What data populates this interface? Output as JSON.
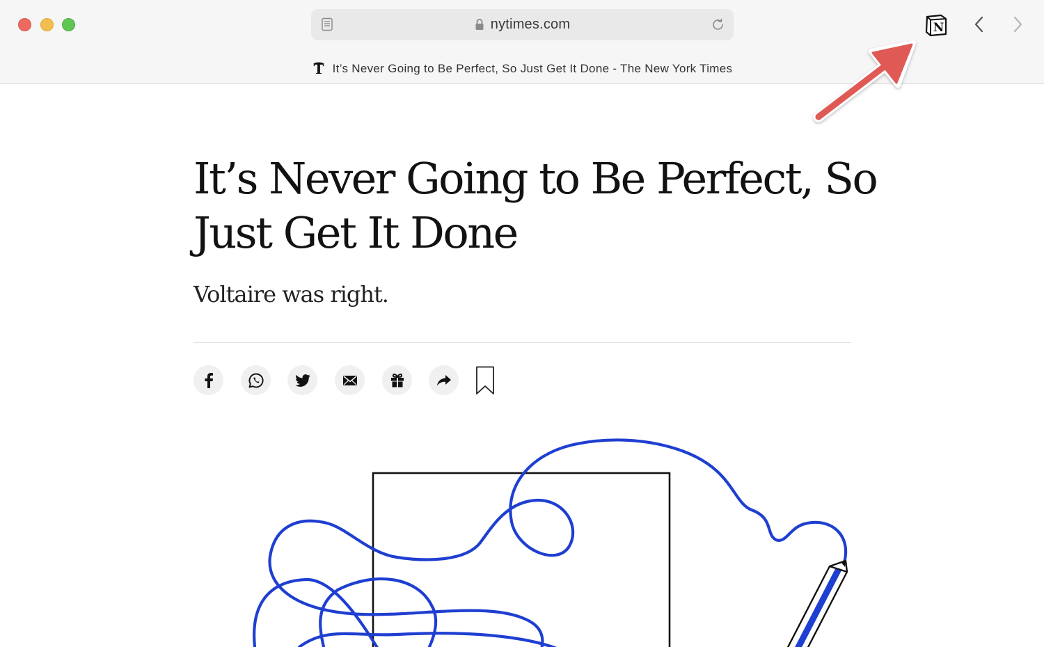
{
  "window": {
    "traffic_lights": {
      "close": "#ec6a5e",
      "minimize": "#f4be4f",
      "maximize": "#61c554"
    }
  },
  "toolbar": {
    "address_bar": {
      "url": "nytimes.com",
      "left_icon": "reader-view-icon",
      "secure_icon": "lock-icon",
      "right_icon": "reload-icon"
    },
    "extension_icon": "notion-icon",
    "back_icon": "chevron-left-icon",
    "forward_icon": "chevron-right-icon",
    "tab": {
      "favicon": "nyt-logo-icon",
      "title": "It’s Never Going to Be Perfect, So Just Get It Done - The New York Times"
    }
  },
  "annotation": {
    "color": "#e05a55",
    "icon": "red-arrow-icon"
  },
  "article": {
    "headline": "It’s Never Going to Be Perfect, So Just Get It Done",
    "summary": "Voltaire was right.",
    "share_buttons": [
      {
        "icon": "facebook-icon"
      },
      {
        "icon": "whatsapp-icon"
      },
      {
        "icon": "twitter-icon"
      },
      {
        "icon": "email-icon"
      },
      {
        "icon": "gift-icon"
      },
      {
        "icon": "share-icon"
      }
    ],
    "save_icon": "bookmark-icon",
    "illustration": {
      "line_color": "#1f3fd1",
      "frame_color": "#121212"
    }
  }
}
